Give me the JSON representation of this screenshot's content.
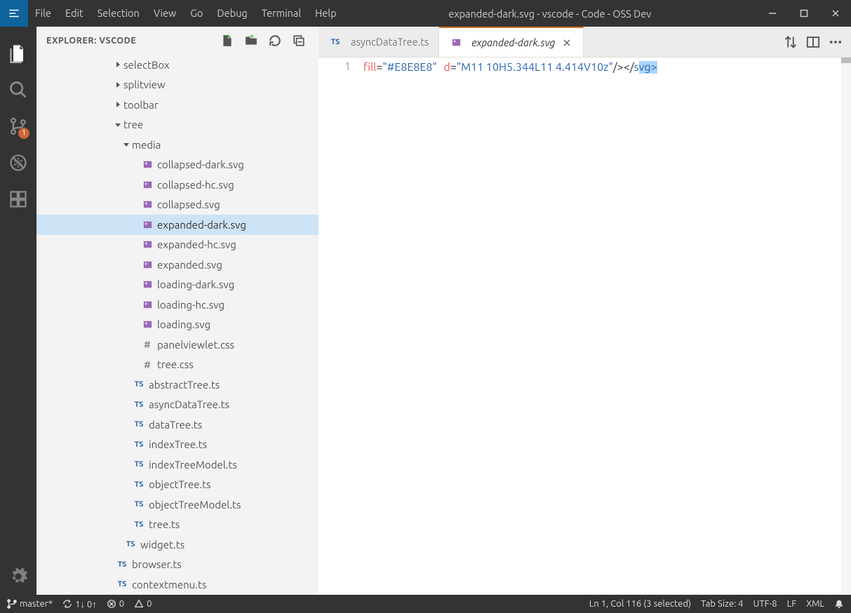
{
  "window_title": "expanded-dark.svg - vscode - Code - OSS Dev",
  "menubar": {
    "items": [
      "File",
      "Edit",
      "Selection",
      "View",
      "Go",
      "Debug",
      "Terminal",
      "Help"
    ]
  },
  "activity": {
    "items": [
      {
        "name": "files-icon",
        "active": true
      },
      {
        "name": "search-icon",
        "active": false
      },
      {
        "name": "branch-icon",
        "active": false,
        "badge": "1"
      },
      {
        "name": "bug-icon",
        "active": false
      },
      {
        "name": "extensions-icon",
        "active": false
      }
    ],
    "bottom": {
      "name": "gear-icon"
    }
  },
  "sidebar": {
    "title": "EXPLORER: VSCODE",
    "header_actions": [
      "new-file-icon",
      "new-folder-icon",
      "refresh-icon",
      "collapse-all-icon"
    ],
    "tree": [
      {
        "depth": 4,
        "kind": "twisty-right",
        "label": "selectBox",
        "type": "folder"
      },
      {
        "depth": 4,
        "kind": "twisty-right",
        "label": "splitview",
        "type": "folder"
      },
      {
        "depth": 4,
        "kind": "twisty-right",
        "label": "toolbar",
        "type": "folder"
      },
      {
        "depth": 4,
        "kind": "twisty-down",
        "label": "tree",
        "type": "folder"
      },
      {
        "depth": 5,
        "kind": "twisty-down",
        "label": "media",
        "type": "folder"
      },
      {
        "depth": 6,
        "kind": "file",
        "label": "collapsed-dark.svg",
        "type": "svg"
      },
      {
        "depth": 6,
        "kind": "file",
        "label": "collapsed-hc.svg",
        "type": "svg"
      },
      {
        "depth": 6,
        "kind": "file",
        "label": "collapsed.svg",
        "type": "svg"
      },
      {
        "depth": 6,
        "kind": "file",
        "label": "expanded-dark.svg",
        "type": "svg",
        "selected": true
      },
      {
        "depth": 6,
        "kind": "file",
        "label": "expanded-hc.svg",
        "type": "svg"
      },
      {
        "depth": 6,
        "kind": "file",
        "label": "expanded.svg",
        "type": "svg"
      },
      {
        "depth": 6,
        "kind": "file",
        "label": "loading-dark.svg",
        "type": "svg"
      },
      {
        "depth": 6,
        "kind": "file",
        "label": "loading-hc.svg",
        "type": "svg"
      },
      {
        "depth": 6,
        "kind": "file",
        "label": "loading.svg",
        "type": "svg"
      },
      {
        "depth": 6,
        "kind": "file",
        "label": "panelviewlet.css",
        "type": "css"
      },
      {
        "depth": 6,
        "kind": "file",
        "label": "tree.css",
        "type": "css"
      },
      {
        "depth": 5,
        "kind": "file",
        "label": "abstractTree.ts",
        "type": "ts"
      },
      {
        "depth": 5,
        "kind": "file",
        "label": "asyncDataTree.ts",
        "type": "ts"
      },
      {
        "depth": 5,
        "kind": "file",
        "label": "dataTree.ts",
        "type": "ts"
      },
      {
        "depth": 5,
        "kind": "file",
        "label": "indexTree.ts",
        "type": "ts"
      },
      {
        "depth": 5,
        "kind": "file",
        "label": "indexTreeModel.ts",
        "type": "ts"
      },
      {
        "depth": 5,
        "kind": "file",
        "label": "objectTree.ts",
        "type": "ts"
      },
      {
        "depth": 5,
        "kind": "file",
        "label": "objectTreeModel.ts",
        "type": "ts"
      },
      {
        "depth": 5,
        "kind": "file",
        "label": "tree.ts",
        "type": "ts"
      },
      {
        "depth": 4,
        "kind": "file",
        "label": "widget.ts",
        "type": "ts"
      },
      {
        "depth": 3,
        "kind": "file",
        "label": "browser.ts",
        "type": "ts"
      },
      {
        "depth": 3,
        "kind": "file",
        "label": "contextmenu.ts",
        "type": "ts"
      }
    ]
  },
  "tabs": [
    {
      "icon": "ts",
      "label": "asyncDataTree.ts",
      "active": false,
      "close": false
    },
    {
      "icon": "svg",
      "label": "expanded-dark.svg",
      "active": true,
      "italic": true,
      "close": true
    }
  ],
  "editor_actions": [
    "compare-icon",
    "split-icon",
    "more-icon"
  ],
  "editor": {
    "line_no": "1",
    "tokens": {
      "t0": "fill",
      "t1": "=",
      "t2": "\"#E8E8E8\"",
      "t3": "d",
      "t4": "=",
      "t5": "\"M11 10H5.344L11 4.414V10z\"",
      "t6": "/></",
      "t7": "s",
      "t8": "vg",
      "t9": ">"
    }
  },
  "statusbar": {
    "branch": "master*",
    "sync": "1↓ 0↑",
    "errors": "0",
    "warnings": "0",
    "cursor": "Ln 1, Col 116 (3 selected)",
    "indent": "Tab Size: 4",
    "encoding": "UTF-8",
    "eol": "LF",
    "lang": "XML"
  }
}
